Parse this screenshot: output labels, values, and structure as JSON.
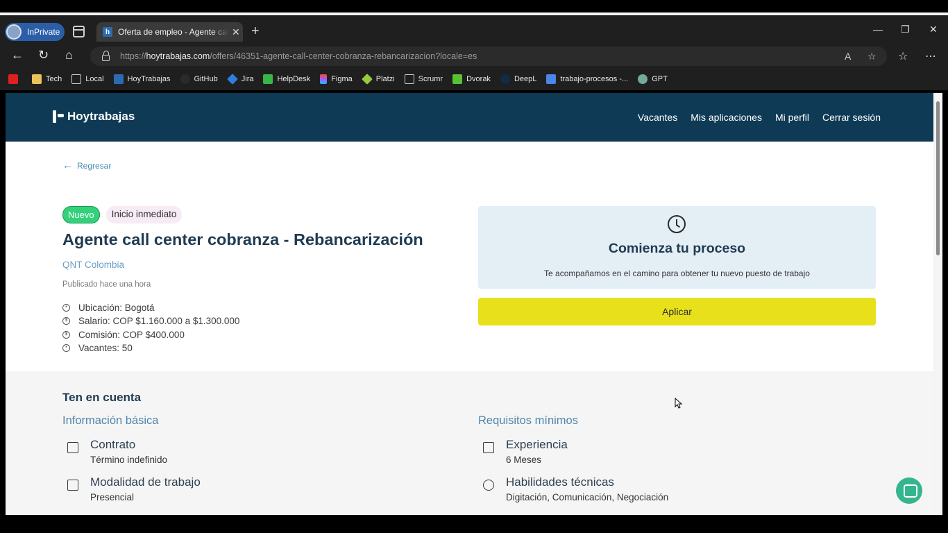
{
  "browser": {
    "inprivate_label": "InPrivate",
    "tab_title": "Oferta de empleo - Agente call center",
    "url_prefix": "https://",
    "url_domain": "hoytrabajas.com",
    "url_path": "/offers/46351-agente-call-center-cobranza-rebancarizacion?locale=es",
    "bookmarks": [
      "Tech",
      "Local",
      "HoyTrabajas",
      "GitHub",
      "Jira",
      "HelpDesk",
      "Figma",
      "Platzi",
      "Scrumr",
      "Dvorak",
      "DeepL",
      "trabajo-procesos -...",
      "GPT"
    ]
  },
  "site": {
    "logo": "Hoytrabajas",
    "nav": [
      "Vacantes",
      "Mis aplicaciones",
      "Mi perfil",
      "Cerrar sesión"
    ]
  },
  "job": {
    "back_label": "Regresar",
    "badge_new": "Nuevo",
    "badge_start": "Inicio inmediato",
    "title": "Agente call center cobranza - Rebancarización",
    "company": "QNT Colombia",
    "published": "Publicado hace una hora",
    "location": "Ubicación: Bogotá",
    "salary": "Salario: COP $1.160.000 a $1.300.000",
    "commission": "Comisión: COP $400.000",
    "vacancies": "Vacantes: 50"
  },
  "process_card": {
    "title": "Comienza tu proceso",
    "subtitle": "Te acompañamos en el camino para obtener tu nuevo puesto de trabajo",
    "apply_label": "Aplicar"
  },
  "info": {
    "section_title": "Ten en cuenta",
    "basic_title": "Información básica",
    "requirements_title": "Requisitos mínimos",
    "contract_label": "Contrato",
    "contract_value": "Término indefinido",
    "modality_label": "Modalidad de trabajo",
    "modality_value": "Presencial",
    "experience_label": "Experiencia",
    "experience_value": "6 Meses",
    "skills_label": "Habilidades técnicas",
    "skills_value": "Digitación, Comunicación, Negociación"
  },
  "colors": {
    "header_bg": "#0e3a55",
    "apply_bg": "#e8e01b",
    "badge_new": "#33d17a",
    "accent_link": "#4f86ad"
  }
}
